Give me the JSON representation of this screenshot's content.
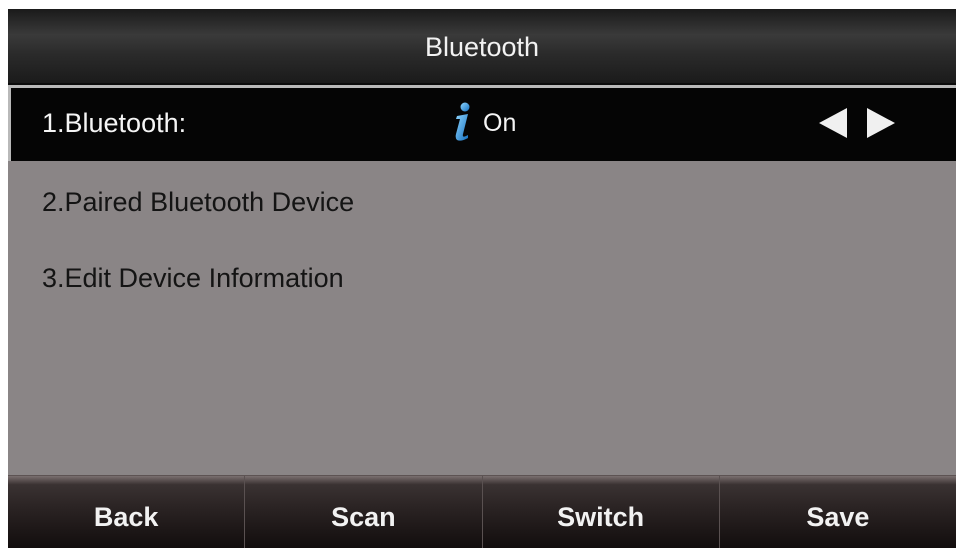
{
  "title": "Bluetooth",
  "menu": {
    "items": [
      {
        "label": "1.Bluetooth:",
        "value": "On",
        "selected": true
      },
      {
        "label": "2.Paired Bluetooth Device"
      },
      {
        "label": "3.Edit Device Information"
      }
    ]
  },
  "softkeys": [
    "Back",
    "Scan",
    "Switch",
    "Save"
  ],
  "icons": {
    "info": "info-icon",
    "left": "arrow-left-icon",
    "right": "arrow-right-icon"
  },
  "colors": {
    "background": "#8a8586",
    "selected_bg": "#050505",
    "info_icon": "#1f8fd6"
  }
}
